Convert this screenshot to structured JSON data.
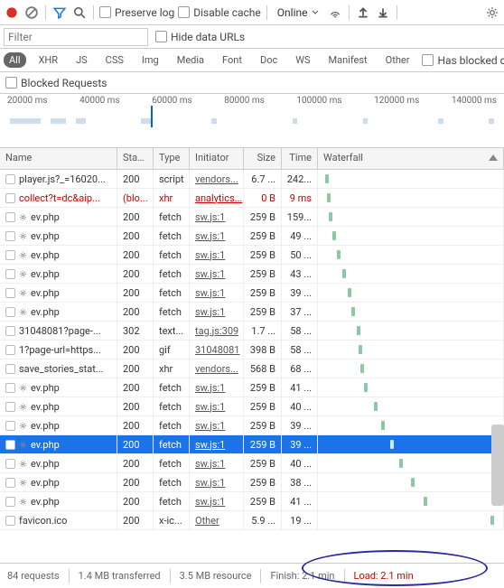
{
  "toolbar": {
    "preserve": "Preserve log",
    "disable": "Disable cache",
    "online": "Online"
  },
  "filter": {
    "placeholder": "Filter",
    "hidedata": "Hide data URLs"
  },
  "types": [
    "All",
    "XHR",
    "JS",
    "CSS",
    "Img",
    "Media",
    "Font",
    "Doc",
    "WS",
    "Manifest",
    "Other"
  ],
  "hasblocked": "Has blocked cookies",
  "blocked": "Blocked Requests",
  "ticks": [
    "20000 ms",
    "40000 ms",
    "60000 ms",
    "80000 ms",
    "100000 ms",
    "120000 ms",
    "140000 ms"
  ],
  "headers": {
    "name": "Name",
    "stat": "Stat...",
    "type": "Type",
    "init": "Initiator",
    "size": "Size",
    "time": "Time",
    "wf": "Waterfall"
  },
  "rows": [
    {
      "n": "player.js?_=16020...",
      "s": "200",
      "t": "script",
      "i": "vendors...",
      "sz": "6.7 ...",
      "tm": "242...",
      "wf": 4,
      "chk": true
    },
    {
      "n": "collect?t=dc&aip...",
      "s": "(blo...",
      "t": "xhr",
      "i": "analytics...",
      "sz": "0 B",
      "tm": "9 ms",
      "wf": 5,
      "chk": true,
      "red": true
    },
    {
      "n": "ev.php",
      "s": "200",
      "t": "fetch",
      "i": "sw.js:1",
      "sz": "259 B",
      "tm": "159...",
      "wf": 6,
      "gear": true
    },
    {
      "n": "ev.php",
      "s": "200",
      "t": "fetch",
      "i": "sw.js:1",
      "sz": "259 B",
      "tm": "49 ...",
      "wf": 8,
      "gear": true
    },
    {
      "n": "ev.php",
      "s": "200",
      "t": "fetch",
      "i": "sw.js:1",
      "sz": "259 B",
      "tm": "50 ...",
      "wf": 10,
      "gear": true
    },
    {
      "n": "ev.php",
      "s": "200",
      "t": "fetch",
      "i": "sw.js:1",
      "sz": "259 B",
      "tm": "43 ...",
      "wf": 13,
      "gear": true
    },
    {
      "n": "ev.php",
      "s": "200",
      "t": "fetch",
      "i": "sw.js:1",
      "sz": "259 B",
      "tm": "39 ...",
      "wf": 16,
      "gear": true
    },
    {
      "n": "ev.php",
      "s": "200",
      "t": "fetch",
      "i": "sw.js:1",
      "sz": "259 B",
      "tm": "37 ...",
      "wf": 18,
      "gear": true
    },
    {
      "n": "31048081?page-...",
      "s": "302",
      "t": "text...",
      "i": "tag.js:309",
      "sz": "1.7 ...",
      "tm": "58 ...",
      "wf": 21,
      "chk": true
    },
    {
      "n": "1?page-url=https...",
      "s": "200",
      "t": "gif",
      "i": "31048081",
      "sz": "398 B",
      "tm": "58 ...",
      "wf": 22,
      "chk": true
    },
    {
      "n": "save_stories_stat...",
      "s": "200",
      "t": "xhr",
      "i": "vendors...",
      "sz": "568 B",
      "tm": "68 ...",
      "wf": 23,
      "chk": true
    },
    {
      "n": "ev.php",
      "s": "200",
      "t": "fetch",
      "i": "sw.js:1",
      "sz": "259 B",
      "tm": "41 ...",
      "wf": 25,
      "gear": true
    },
    {
      "n": "ev.php",
      "s": "200",
      "t": "fetch",
      "i": "sw.js:1",
      "sz": "259 B",
      "tm": "40 ...",
      "wf": 30,
      "gear": true
    },
    {
      "n": "ev.php",
      "s": "200",
      "t": "fetch",
      "i": "sw.js:1",
      "sz": "259 B",
      "tm": "39 ...",
      "wf": 34,
      "gear": true
    },
    {
      "n": "ev.php",
      "s": "200",
      "t": "fetch",
      "i": "sw.js:1",
      "sz": "259 B",
      "tm": "39 ...",
      "wf": 39,
      "gear": true,
      "sel": true
    },
    {
      "n": "ev.php",
      "s": "200",
      "t": "fetch",
      "i": "sw.js:1",
      "sz": "259 B",
      "tm": "40 ...",
      "wf": 44,
      "gear": true
    },
    {
      "n": "ev.php",
      "s": "200",
      "t": "fetch",
      "i": "sw.js:1",
      "sz": "259 B",
      "tm": "38 ...",
      "wf": 50,
      "gear": true
    },
    {
      "n": "ev.php",
      "s": "200",
      "t": "fetch",
      "i": "sw.js:1",
      "sz": "259 B",
      "tm": "41 ...",
      "wf": 57,
      "gear": true
    },
    {
      "n": "favicon.ico",
      "s": "200",
      "t": "x-ic...",
      "i": "Other",
      "sz": "5.9 ...",
      "tm": "19 ...",
      "wf": 93,
      "chk": true
    }
  ],
  "status": {
    "req": "84 requests",
    "xfer": "1.4 MB transferred",
    "res": "3.5 MB resource",
    "fin": "Finish: 2.1 min",
    "load": "Load: 2.1 min"
  }
}
